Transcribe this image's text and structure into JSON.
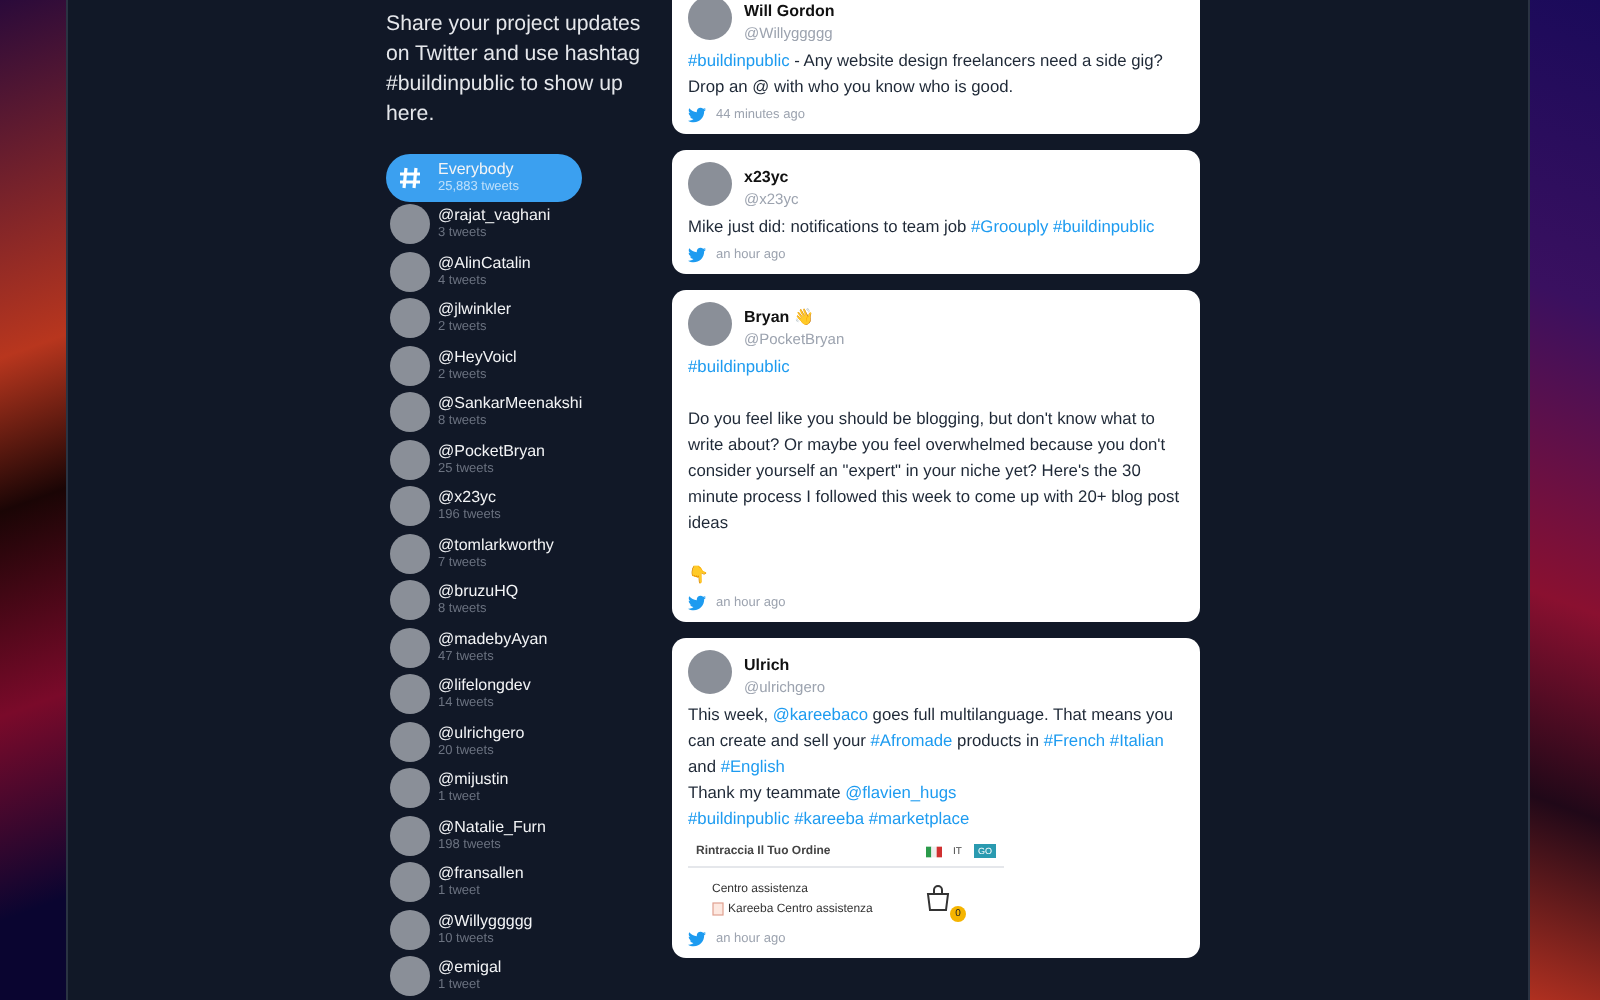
{
  "intro": "Share your project updates on Twitter and use hashtag #buildinpublic to show up here.",
  "people": [
    {
      "name": "Everybody",
      "count": "25,883 tweets",
      "selected": true,
      "kind": "hashtag"
    },
    {
      "name": "@rajat_vaghani",
      "count": "3 tweets",
      "selected": false,
      "kind": "person"
    },
    {
      "name": "@AlinCatalin",
      "count": "4 tweets",
      "selected": false,
      "kind": "person"
    },
    {
      "name": "@jlwinkler",
      "count": "2 tweets",
      "selected": false,
      "kind": "person"
    },
    {
      "name": "@HeyVoicl",
      "count": "2 tweets",
      "selected": false,
      "kind": "person"
    },
    {
      "name": "@SankarMeenakshi",
      "count": "8 tweets",
      "selected": false,
      "kind": "person"
    },
    {
      "name": "@PocketBryan",
      "count": "25 tweets",
      "selected": false,
      "kind": "person"
    },
    {
      "name": "@x23yc",
      "count": "196 tweets",
      "selected": false,
      "kind": "person"
    },
    {
      "name": "@tomlarkworthy",
      "count": "7 tweets",
      "selected": false,
      "kind": "person"
    },
    {
      "name": "@bruzuHQ",
      "count": "8 tweets",
      "selected": false,
      "kind": "person"
    },
    {
      "name": "@madebyAyan",
      "count": "47 tweets",
      "selected": false,
      "kind": "person"
    },
    {
      "name": "@lifelongdev",
      "count": "14 tweets",
      "selected": false,
      "kind": "person"
    },
    {
      "name": "@ulrichgero",
      "count": "20 tweets",
      "selected": false,
      "kind": "person"
    },
    {
      "name": "@mijustin",
      "count": "1 tweet",
      "selected": false,
      "kind": "person"
    },
    {
      "name": "@Natalie_Furn",
      "count": "198 tweets",
      "selected": false,
      "kind": "person"
    },
    {
      "name": "@fransallen",
      "count": "1 tweet",
      "selected": false,
      "kind": "person"
    },
    {
      "name": "@Willyggggg",
      "count": "10 tweets",
      "selected": false,
      "kind": "person"
    },
    {
      "name": "@emigal",
      "count": "1 tweet",
      "selected": false,
      "kind": "person"
    }
  ],
  "tweets": [
    {
      "name": "Will Gordon",
      "handle": "@Willyggggg",
      "time": "44 minutes ago",
      "body": [
        {
          "kind": "hashtag",
          "text": "#buildinpublic"
        },
        {
          "kind": "text",
          "text": " - Any website design freelancers need a side gig? Drop an @ with who you know who is good."
        }
      ]
    },
    {
      "name": "x23yc",
      "handle": "@x23yc",
      "time": "an hour ago",
      "body": [
        {
          "kind": "text",
          "text": "Mike just did: notifications to team job "
        },
        {
          "kind": "hashtag",
          "text": "#Groouply "
        },
        {
          "kind": "hashtag",
          "text": "#buildinpublic"
        }
      ]
    },
    {
      "name": "Bryan 👋",
      "handle": "@PocketBryan",
      "time": "an hour ago",
      "body": [
        {
          "kind": "hashtag",
          "text": "#buildinpublic"
        },
        {
          "kind": "text",
          "text": "\n\nDo you feel like you should be blogging, but don't know what to write about? Or maybe you feel overwhelmed because you don't consider yourself an \"expert\" in your niche yet? Here's the 30 minute process I followed this week to come up with 20+ blog post ideas\n\n👇"
        }
      ]
    },
    {
      "name": "Ulrich",
      "handle": "@ulrichgero",
      "time": "an hour ago",
      "body": [
        {
          "kind": "text",
          "text": "This week, "
        },
        {
          "kind": "mention",
          "text": "@kareebaco"
        },
        {
          "kind": "text",
          "text": " goes full multilanguage. That means you can create and sell your "
        },
        {
          "kind": "hashtag",
          "text": "#Afromade"
        },
        {
          "kind": "text",
          "text": " products in "
        },
        {
          "kind": "hashtag",
          "text": "#French "
        },
        {
          "kind": "hashtag",
          "text": "#Italian"
        },
        {
          "kind": "text",
          "text": " and "
        },
        {
          "kind": "hashtag",
          "text": "#English"
        },
        {
          "kind": "text",
          "text": "\nThank my teammate "
        },
        {
          "kind": "mention",
          "text": "@flavien_hugs"
        },
        {
          "kind": "break"
        },
        {
          "kind": "hashtag",
          "text": "#buildinpublic "
        },
        {
          "kind": "hashtag",
          "text": "#kareeba "
        },
        {
          "kind": "hashtag",
          "text": "#marketplace"
        }
      ],
      "media": {
        "title": "Rintraccia Il Tuo Ordine",
        "language": "IT",
        "go": "GO",
        "heading": "Centro assistenza",
        "link": "Kareeba Centro assistenza",
        "cart_count": "0"
      }
    }
  ]
}
